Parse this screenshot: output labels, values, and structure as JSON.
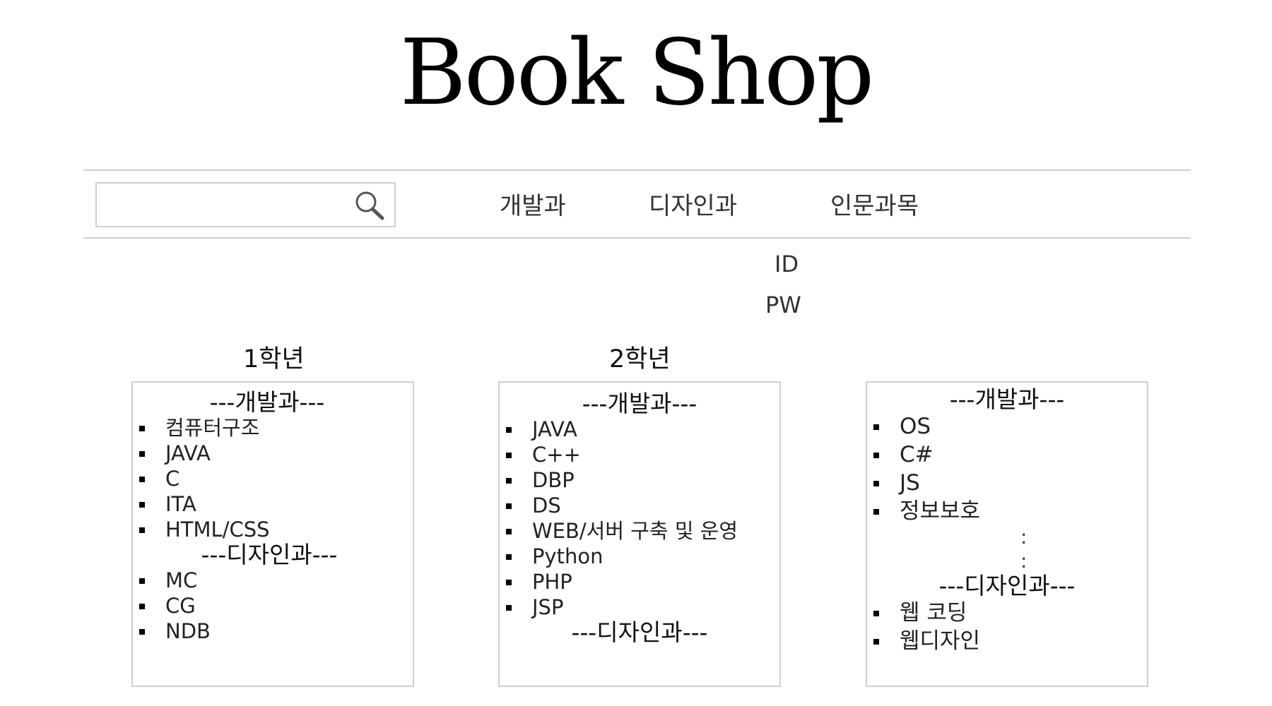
{
  "header": {
    "title": "Book Shop"
  },
  "search": {
    "value": "",
    "icon": "search-icon"
  },
  "nav": [
    {
      "label": "개발과"
    },
    {
      "label": "디자인과"
    },
    {
      "label": "인문과목"
    }
  ],
  "login": {
    "id_label": "ID",
    "pw_label": "PW"
  },
  "grades": [
    {
      "label": "1학년"
    },
    {
      "label": "2학년"
    }
  ],
  "boxes": [
    {
      "dev_heading": "---개발과---",
      "dev_items": [
        "컴퓨터구조",
        "JAVA",
        "C",
        "ITA",
        "HTML/CSS"
      ],
      "design_heading": "---디자인과---",
      "design_items": [
        "MC",
        "CG",
        "NDB"
      ]
    },
    {
      "dev_heading": "---개발과---",
      "dev_items": [
        "JAVA",
        "C++",
        "DBP",
        "DS",
        "WEB/서버 구축 및 운영",
        "Python",
        "PHP",
        "JSP"
      ],
      "design_heading": "---디자인과---",
      "design_items": []
    },
    {
      "dev_heading": "---개발과---",
      "dev_items": [
        "OS",
        "C#",
        "JS",
        "정보보호"
      ],
      "continuation": ":",
      "design_heading": "---디자인과---",
      "design_items": [
        "웹 코딩",
        "웹디자인"
      ]
    }
  ]
}
